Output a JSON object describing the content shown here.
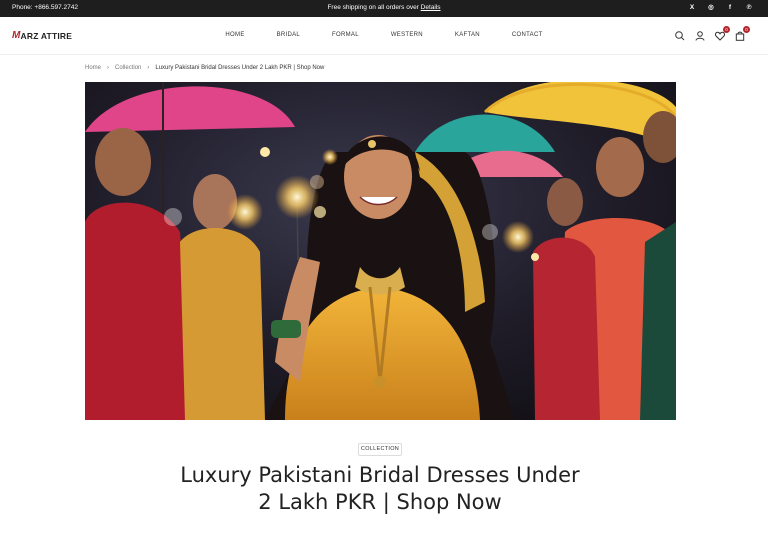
{
  "announcement": {
    "phone": "Phone: +866.597.2742",
    "promo_text": "Free shipping on all orders over",
    "promo_link": "Details",
    "social": [
      {
        "icon": "x-twitter-icon",
        "glyph": "X"
      },
      {
        "icon": "instagram-icon",
        "glyph": "◎"
      },
      {
        "icon": "facebook-icon",
        "glyph": "f"
      },
      {
        "icon": "pinterest-icon",
        "glyph": "℗"
      }
    ]
  },
  "header": {
    "logo_mark": "M",
    "logo_text": "ARZ ATTIRE",
    "nav": [
      "HOME",
      "BRIDAL",
      "FORMAL",
      "WESTERN",
      "KAFTAN",
      "CONTACT"
    ],
    "wishlist_count": "0",
    "cart_count": "0"
  },
  "breadcrumb": {
    "home": "Home",
    "collection": "Collection",
    "current": "Luxury Pakistani Bridal Dresses Under 2 Lakh PKR | Shop Now"
  },
  "article": {
    "tag": "COLLECTION",
    "title": "Luxury Pakistani Bridal Dresses Under 2 Lakh PKR | Shop Now"
  },
  "colors": {
    "topbar_bg": "#1e1e1e",
    "accent": "#b3262e"
  }
}
